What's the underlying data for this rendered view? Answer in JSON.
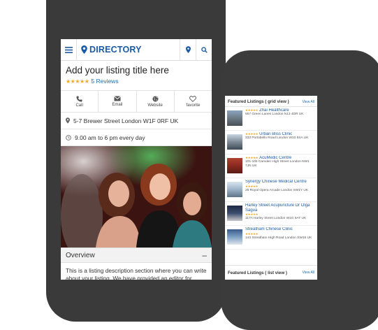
{
  "header": {
    "brand": "DIRECTORY"
  },
  "listing": {
    "title": "Add your listing title here",
    "stars": "★★★★★",
    "reviews": "5 Reviews"
  },
  "actions": [
    {
      "label": "Call",
      "icon": "phone-icon"
    },
    {
      "label": "Email",
      "icon": "email-icon"
    },
    {
      "label": "Website",
      "icon": "globe-icon"
    },
    {
      "label": "favorite",
      "icon": "heart-icon"
    }
  ],
  "info": {
    "address": "5-7 Brewer Street London W1F 0RF UK",
    "hours": "9.00 am to 6 pm every day"
  },
  "overview": {
    "title": "Overview",
    "toggle": "–",
    "description": "This is a listing description section where you can write about your listing. We have provided an editor for entering this information on Submit listing page so your"
  },
  "featured": {
    "grid_title": "Featured Listings ( grid view )",
    "list_title": "Featured Listings ( list view )",
    "view_all": "View All",
    "items": [
      {
        "name": "Zhai Healthcare",
        "address": "557 Green Lanes London N13 4DR UK",
        "stars": "★★★★★"
      },
      {
        "name": "Urban Bliss Clinic",
        "address": "333 Portobello Road London W10 5SA UK",
        "stars": "★★★★★"
      },
      {
        "name": "AcuMedic Centre",
        "address": "101-105 Camden High Street London NW1 7JN UK",
        "stars": "★★★★★"
      },
      {
        "name": "Synergy Chinese Medical Centre",
        "address": "25 Royal Opera Arcade London SW1Y UK",
        "stars": "★★★★★"
      },
      {
        "name": "Harley Street Acupuncture Dr Olga Sagua",
        "address": "117A Harley Street London W1G 6AT UK",
        "stars": "★★★★★"
      },
      {
        "name": "Streatham Chinese Clinic",
        "address": "143 Streatham High Road London SW16 UK",
        "stars": "★★★★★"
      }
    ]
  },
  "colors": {
    "brand": "#1a5aa6",
    "star": "#f5a623",
    "frame": "#3a3a3a"
  }
}
